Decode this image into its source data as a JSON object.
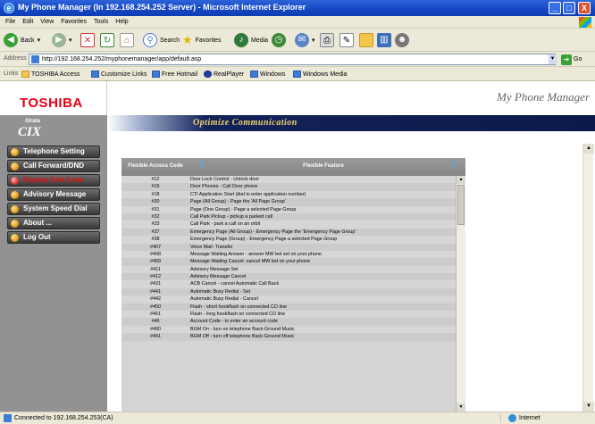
{
  "window": {
    "title": "My Phone Manager (In 192.168.254.252 Server) - Microsoft Internet Explorer",
    "controls": [
      "_",
      "□",
      "X"
    ]
  },
  "menubar": [
    "File",
    "Edit",
    "View",
    "Favorites",
    "Tools",
    "Help"
  ],
  "toolbar": {
    "back": "Back",
    "search": "Search",
    "favorites": "Favorites",
    "media": "Media"
  },
  "address": {
    "label": "Address",
    "url": "http://192.168.254.252/myphonemanager/app/default.asp",
    "go": "Go"
  },
  "links": {
    "label": "Links",
    "items": [
      "TOSHIBA Access",
      "Customize Links",
      "Free Hotmail",
      "RealPlayer",
      "Windows",
      "Windows Media"
    ]
  },
  "header": {
    "logo": "TOSHIBA",
    "app_title": "My Phone Manager",
    "tagline": "Optimize Communication",
    "product_brand": "Strata",
    "product_mark": "CIX"
  },
  "sidebar": {
    "items": [
      {
        "label": "Telephone Setting",
        "active": false
      },
      {
        "label": "Call Forward/DND",
        "active": false
      },
      {
        "label": "Display Dial Code",
        "active": true
      },
      {
        "label": "Advisory Message",
        "active": false
      },
      {
        "label": "System Speed Dial",
        "active": false
      },
      {
        "label": "About ...",
        "active": false
      },
      {
        "label": "Log Out",
        "active": false
      }
    ]
  },
  "table": {
    "columns": [
      "Flexible Access Code",
      "Flexible Feature"
    ],
    "rows": [
      {
        "code": "#12",
        "feature": "Door Lock Control - Unlock door"
      },
      {
        "code": "#15",
        "feature": "Door Phones - Call Door phone"
      },
      {
        "code": "#18",
        "feature": "CTI Application Start (dial to enter application number)"
      },
      {
        "code": "#30",
        "feature": "Page (All Group) - Page the 'All Page Group'"
      },
      {
        "code": "#31",
        "feature": "Page (One Group) - Page a selected Page Group"
      },
      {
        "code": "#32",
        "feature": "Call Park Pickup - pickup a parked call"
      },
      {
        "code": "#33",
        "feature": "Call Park - park a call on an orbit"
      },
      {
        "code": "#37",
        "feature": "Emergency Page (All Group) - Emergency Page the 'Emergency Page Group'"
      },
      {
        "code": "#38",
        "feature": "Emergency Page (Group) - Emergency Page a selected Page Group"
      },
      {
        "code": "#407",
        "feature": "Voice Mail- Transfer"
      },
      {
        "code": "#408",
        "feature": "Message Waiting Answer - answer MW led set on your phone"
      },
      {
        "code": "#409",
        "feature": "Message Waiting Cancel- cancel MW led on your phone"
      },
      {
        "code": "#411",
        "feature": "Advisory Message Set"
      },
      {
        "code": "#412",
        "feature": "Advisory Message Cancel"
      },
      {
        "code": "#431",
        "feature": "ACB Cancel - cancel Automatic Call Back"
      },
      {
        "code": "#441",
        "feature": "Automatic Busy Redial - Set"
      },
      {
        "code": "#442",
        "feature": "Automatic Busy Redial - Cancel"
      },
      {
        "code": "#450",
        "feature": "Flash - short hookflash on connected CO line"
      },
      {
        "code": "#451",
        "feature": "Flash - long hookflash on connected CO line"
      },
      {
        "code": "#46",
        "feature": "Account Code - to enter an account code"
      },
      {
        "code": "#490",
        "feature": "BGM On - turn on telephone Back-Ground Music"
      },
      {
        "code": "#491",
        "feature": "BGM Off - turn off telephone Back-Ground Music"
      }
    ]
  },
  "status": {
    "text": "Connected to 192.168.254.253(CA)",
    "zone": "Internet"
  }
}
